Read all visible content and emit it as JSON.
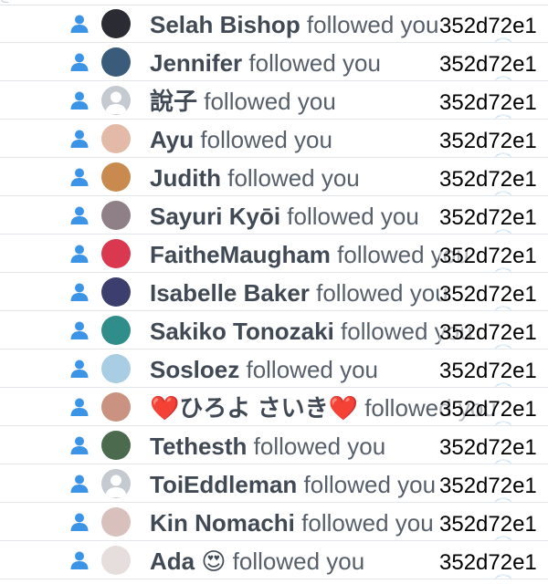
{
  "notifications": {
    "rows": [
      {
        "name": "Selah Bishop",
        "action": " followed you",
        "id": "352d72e1",
        "avatar": "#2b2b33"
      },
      {
        "name": "Jennifer",
        "action": " followed you",
        "id": "352d72e1",
        "avatar": "#3b5b7a"
      },
      {
        "name": "說子",
        "action": " followed you",
        "id": "352d72e1",
        "avatar": "default"
      },
      {
        "name": "Ayu",
        "action": " followed you",
        "id": "352d72e1",
        "avatar": "#e3b9a8"
      },
      {
        "name": "Judith",
        "action": " followed you",
        "id": "352d72e1",
        "avatar": "#c98a50"
      },
      {
        "name": "Sayuri Kyōi",
        "action": " followed you",
        "id": "352d72e1",
        "avatar": "#8f7f86"
      },
      {
        "name": "FaitheMaugham",
        "action": " followed you",
        "id": "352d72e1",
        "avatar": "#d9384f"
      },
      {
        "name": "Isabelle Baker",
        "action": " followed you",
        "id": "352d72e1",
        "avatar": "#3c3f6e"
      },
      {
        "name": "Sakiko Tonozaki",
        "action": " followed you",
        "id": "352d72e1",
        "avatar": "#2f8e8a"
      },
      {
        "name": "Sosloez",
        "action": " followed you",
        "id": "352d72e1",
        "avatar": "#a9cde2"
      },
      {
        "name": "❤️ひろよ さいき❤️",
        "action": " followed you",
        "id": "352d72e1",
        "avatar": "#c99281"
      },
      {
        "name": "Tethesth",
        "action": " followed you",
        "id": "352d72e1",
        "avatar": "#4c6b4e"
      },
      {
        "name": "ToiEddleman",
        "action": " followed you",
        "id": "352d72e1",
        "avatar": "default"
      },
      {
        "name": "Kin Nomachi",
        "action": " followed you",
        "id": "352d72e1",
        "avatar": "#d8c0bd"
      },
      {
        "name": "Ada 😍",
        "action": " followed you",
        "id": "352d72e1",
        "avatar": "#e6dedc"
      }
    ]
  },
  "colors": {
    "follow_icon": "#3b94e6",
    "name_text": "#414a54",
    "action_text": "#57606a",
    "divider": "#e3e6ea"
  },
  "icons": {
    "follow": "person-icon",
    "default_avatar": "default-avatar-icon"
  }
}
